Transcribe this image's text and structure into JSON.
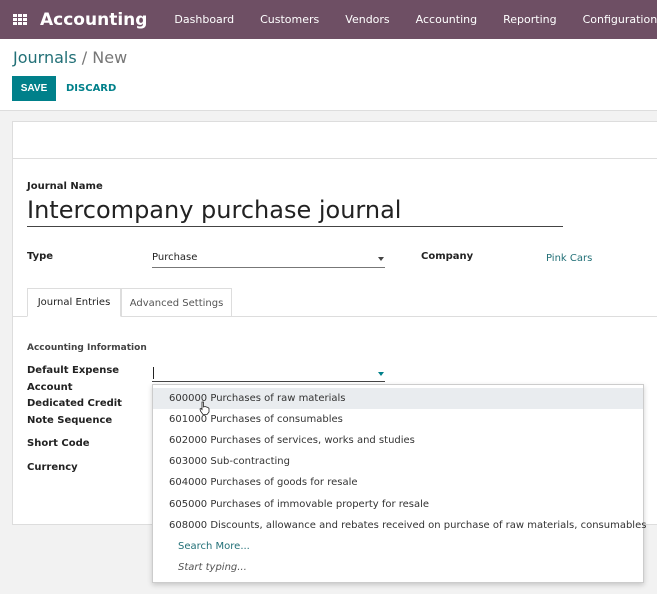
{
  "navbar": {
    "app_name": "Accounting",
    "menu": [
      "Dashboard",
      "Customers",
      "Vendors",
      "Accounting",
      "Reporting",
      "Configuration"
    ]
  },
  "breadcrumb": {
    "parent": "Journals",
    "separator": "/",
    "current": "New"
  },
  "buttons": {
    "save": "SAVE",
    "discard": "DISCARD"
  },
  "form": {
    "journal_name_label": "Journal Name",
    "journal_name_value": "Intercompany purchase journal",
    "type_label": "Type",
    "type_value": "Purchase",
    "company_label": "Company",
    "company_value": "Pink Cars",
    "tabs": [
      "Journal Entries",
      "Advanced Settings"
    ],
    "section_title": "Accounting Information",
    "fields": {
      "default_expense_account": "Default Expense Account",
      "dedicated_credit_note_sequence": "Dedicated Credit Note Sequence",
      "short_code": "Short Code",
      "currency": "Currency"
    }
  },
  "dropdown": {
    "options": [
      "600000 Purchases of raw materials",
      "601000 Purchases of consumables",
      "602000 Purchases of services, works and studies",
      "603000 Sub-contracting",
      "604000 Purchases of goods for resale",
      "605000 Purchases of immovable property for resale",
      "608000 Discounts, allowance and rebates received on purchase of raw materials, consumables"
    ],
    "search_more": "Search More...",
    "start_typing": "Start typing..."
  },
  "colors": {
    "navbar": "#6e4f64",
    "primary": "#00808a",
    "link": "#227077"
  }
}
